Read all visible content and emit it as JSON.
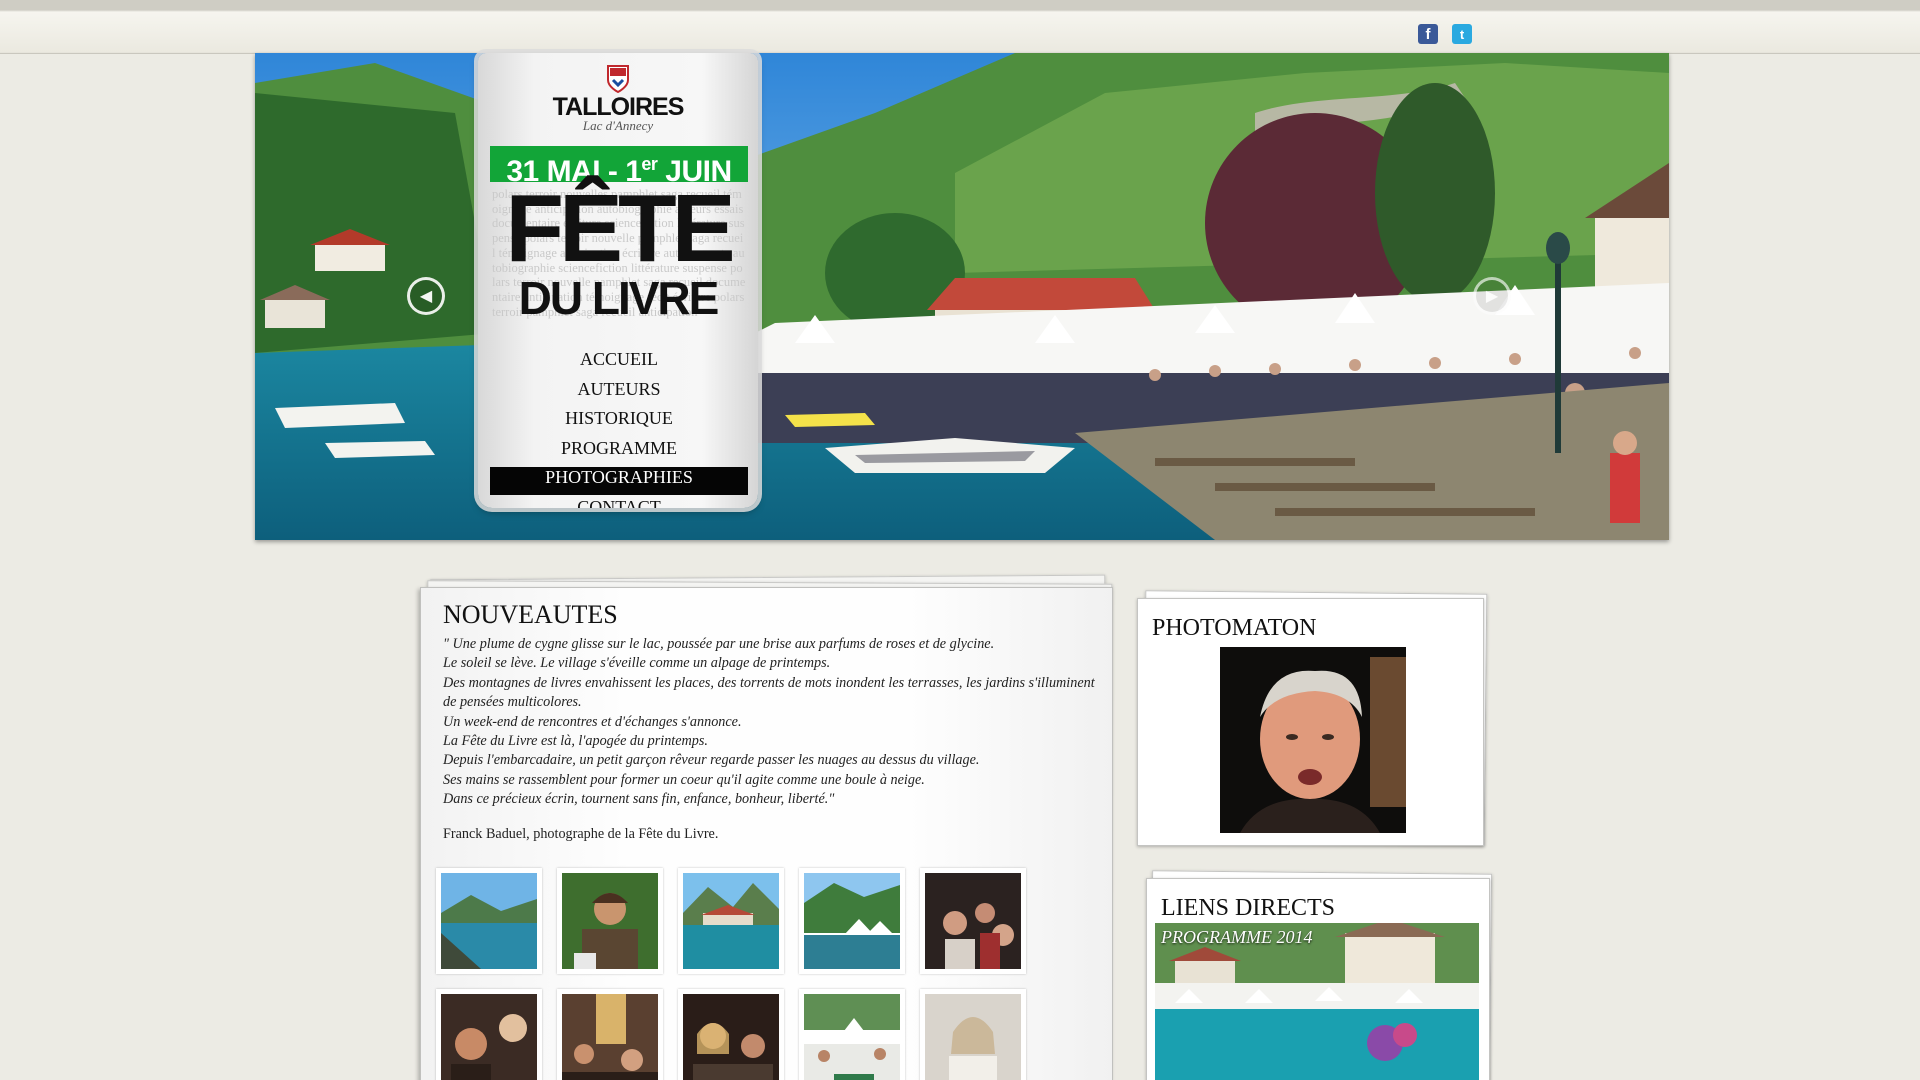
{
  "header": {
    "social": [
      {
        "name": "facebook-icon",
        "glyph": "f"
      },
      {
        "name": "twitter-icon",
        "glyph": "t"
      }
    ]
  },
  "brand": {
    "town": "TALLOIRES",
    "subtitle": "Lac d'Annecy",
    "dates": "31 MAI - 1er JUIN",
    "title_line1": "FÊTE",
    "title_line2": "DU LIVRE",
    "bg_words": "polars terroir nouvelles pamphlet saga recueil témoignage anticipation autobiographie auteurs essais documentaire écriture sciencefiction littérature suspense polars terroir nouvelle pamphlet saga recueil témoignage anticipation écriture auteurs conte autobiographie sciencefiction littérature suspense polars terroir nouvelle pamphlet saga recueil documentaire anticipation témoignage récit écriture polars terroir pamphlet saga recueil anticipation"
  },
  "menu": {
    "items": [
      {
        "label": "Accueil",
        "active": false
      },
      {
        "label": "Auteurs",
        "active": false
      },
      {
        "label": "Historique",
        "active": false
      },
      {
        "label": "Programme",
        "active": false
      },
      {
        "label": "Photographies",
        "active": true
      },
      {
        "label": "Contact",
        "active": false
      }
    ],
    "pager": {
      "total": 5,
      "current": 1
    }
  },
  "colors": {
    "accent_green": "#12a538",
    "background": "#ecebe4",
    "menu_active_bg": "#050505"
  },
  "news": {
    "title": "NOUVEAUTES",
    "poem": [
      "\" Une plume de cygne glisse sur le lac, poussée par une brise aux parfums de roses et de glycine.",
      "Le soleil se lève. Le village s'éveille comme un alpage de printemps.",
      "Des montagnes de livres envahissent les places, des torrents de mots inondent les terrasses, les jardins s'illuminent de pensées multicolores.",
      "Un week-end de rencontres et d'échanges s'annonce.",
      "La Fête du Livre est là, l'apogée du printemps.",
      "Depuis l'embarcadaire, un petit garçon rêveur regarde passer les nuages au dessus du village.",
      "Ses mains se rassemblent pour former un coeur qu'il agite comme une boule à neige.",
      "Dans ce précieux écrin, tournent sans fin, enfance, bonheur, liberté.\""
    ],
    "credit": "Franck Baduel, photographe de la Fête du Livre.",
    "thumbnails": [
      "lake-view",
      "author-portrait",
      "lake-village",
      "festival-tents",
      "crowd-table",
      "smiling-men",
      "dinner-room",
      "woman-table",
      "tent-tables",
      "woman-book"
    ]
  },
  "photomaton": {
    "title": "PHOTOMATON"
  },
  "links": {
    "title": "LIENS DIRECTS",
    "program_label": "PROGRAMME 2014"
  }
}
